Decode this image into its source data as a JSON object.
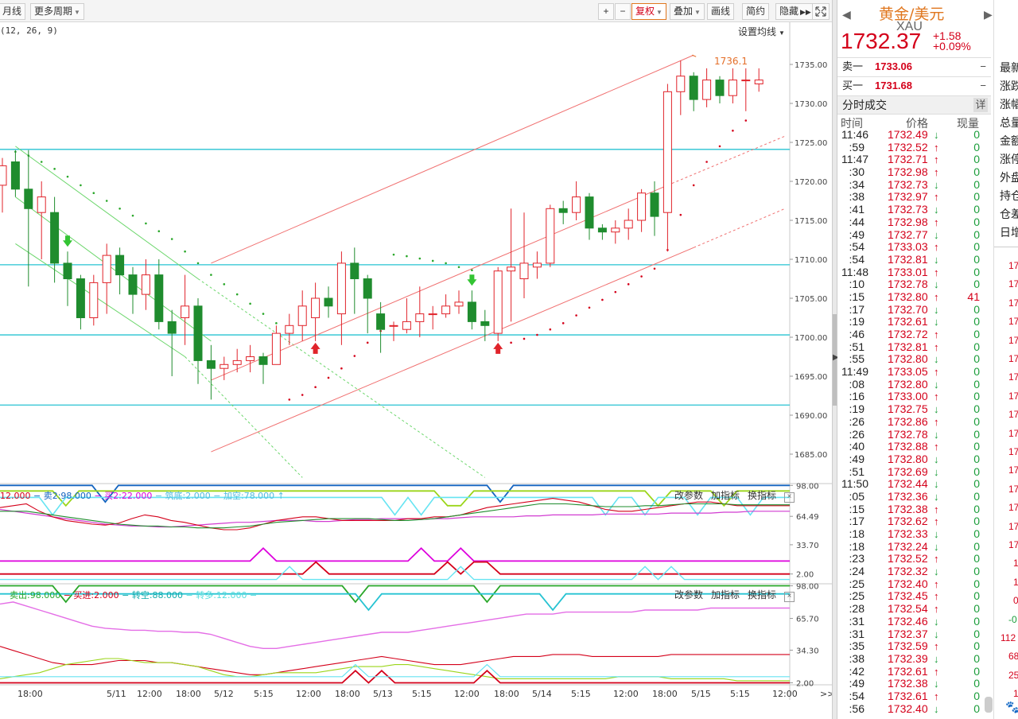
{
  "toolbar": {
    "monthly": "月线",
    "more_periods": "更多周期",
    "plus": "+",
    "minus": "−",
    "adjust": "复权",
    "overlay": "叠加",
    "draw": "画线",
    "simple": "简约",
    "hide": "隐藏",
    "hide_arrows": "▶▶",
    "fullscreen_icon": "fullscreen-icon"
  },
  "chart_header": {
    "macd_params": "(12, 26, 9)",
    "set_ma": "设置均线"
  },
  "colors": {
    "up": "#e0232a",
    "down": "#1f8c2e",
    "hline": "#27c3d2",
    "channel_red": "#f07070",
    "channel_green": "#6bd66b",
    "price_red": "#d4001a",
    "ma_orange": "#e46f2a"
  },
  "chart_data": {
    "type": "candlestick",
    "ylim": [
      1681.5,
      1737.5
    ],
    "yticks": [
      "1735.00",
      "1730.00",
      "1725.00",
      "1720.00",
      "1715.00",
      "1710.00",
      "1705.00",
      "1700.00",
      "1695.00",
      "1690.00",
      "1685.00"
    ],
    "ytick_values": [
      1735,
      1730,
      1725,
      1720,
      1715,
      1710,
      1705,
      1700,
      1695,
      1690,
      1685
    ],
    "xticks": [
      "18:00",
      "5/11",
      "12:00",
      "18:00",
      "5/12",
      "5:15",
      "12:00",
      "18:00",
      "5/13",
      "5:15",
      "12:00",
      "18:00",
      "5/14",
      "5:15",
      "12:00",
      "18:00",
      "5/15",
      "5:15",
      "12:00"
    ],
    "peak_label": "1736.1",
    "horizontal_levels": [
      1724.1,
      1709.3,
      1700.3,
      1691.3
    ],
    "candles": [
      [
        1719.5,
        1722.0,
        1716.0,
        1723.0
      ],
      [
        1722.5,
        1719.0,
        1718.0,
        1724.0
      ],
      [
        1719.0,
        1716.5,
        1706.5,
        1724.0
      ],
      [
        1716.0,
        1718.0,
        1710.0,
        1720.0
      ],
      [
        1716.0,
        1709.5,
        1707.0,
        1718.0
      ],
      [
        1709.5,
        1707.5,
        1704.0,
        1711.0
      ],
      [
        1707.5,
        1702.5,
        1701.0,
        1708.0
      ],
      [
        1702.5,
        1707.0,
        1701.5,
        1708.0
      ],
      [
        1707.0,
        1710.5,
        1703.0,
        1712.0
      ],
      [
        1710.5,
        1708.0,
        1705.5,
        1711.5
      ],
      [
        1708.0,
        1705.5,
        1703.0,
        1709.0
      ],
      [
        1705.5,
        1708.0,
        1703.5,
        1710.0
      ],
      [
        1708.0,
        1702.0,
        1701.0,
        1710.0
      ],
      [
        1702.0,
        1700.5,
        1695.0,
        1703.5
      ],
      [
        1702.5,
        1704.0,
        1699.0,
        1708.0
      ],
      [
        1704.0,
        1697.0,
        1694.0,
        1705.0
      ],
      [
        1697.0,
        1696.0,
        1692.0,
        1699.0
      ],
      [
        1696.0,
        1696.5,
        1694.5,
        1697.5
      ],
      [
        1696.5,
        1697.0,
        1695.5,
        1698.5
      ],
      [
        1697.0,
        1697.5,
        1695.5,
        1699.0
      ],
      [
        1697.5,
        1696.5,
        1694.0,
        1698.0
      ],
      [
        1696.5,
        1700.5,
        1696.5,
        1701.5
      ],
      [
        1700.5,
        1701.5,
        1699.0,
        1703.0
      ],
      [
        1701.5,
        1704.0,
        1699.5,
        1706.0
      ],
      [
        1702.5,
        1705.0,
        1699.5,
        1707.0
      ],
      [
        1705.0,
        1704.0,
        1702.5,
        1706.5
      ],
      [
        1703.0,
        1709.5,
        1699.0,
        1711.0
      ],
      [
        1709.5,
        1707.5,
        1703.0,
        1711.5
      ],
      [
        1707.5,
        1705.0,
        1700.5,
        1708.0
      ],
      [
        1703.0,
        1701.0,
        1698.0,
        1704.5
      ],
      [
        1701.5,
        1701.5,
        1699.5,
        1702.0
      ],
      [
        1701.0,
        1702.0,
        1700.5,
        1705.0
      ],
      [
        1702.0,
        1703.0,
        1700.0,
        1706.5
      ],
      [
        1703.0,
        1703.0,
        1701.0,
        1704.0
      ],
      [
        1703.0,
        1704.0,
        1702.5,
        1705.5
      ],
      [
        1704.0,
        1704.5,
        1703.0,
        1706.0
      ],
      [
        1704.5,
        1702.0,
        1701.0,
        1706.0
      ],
      [
        1702.0,
        1701.5,
        1699.5,
        1703.5
      ],
      [
        1700.5,
        1708.5,
        1699.5,
        1709.0
      ],
      [
        1708.5,
        1709.0,
        1702.0,
        1716.5
      ],
      [
        1707.5,
        1709.5,
        1705.0,
        1716.0
      ],
      [
        1709.0,
        1709.5,
        1707.5,
        1711.0
      ],
      [
        1709.5,
        1716.5,
        1709.0,
        1717.0
      ],
      [
        1716.5,
        1716.0,
        1714.5,
        1717.5
      ],
      [
        1716.0,
        1718.0,
        1715.0,
        1720.0
      ],
      [
        1718.0,
        1714.0,
        1712.5,
        1718.5
      ],
      [
        1714.0,
        1713.5,
        1712.5,
        1714.5
      ],
      [
        1713.5,
        1714.0,
        1712.0,
        1715.0
      ],
      [
        1714.0,
        1715.0,
        1712.5,
        1716.5
      ],
      [
        1715.0,
        1718.5,
        1713.5,
        1719.0
      ],
      [
        1718.5,
        1715.5,
        1713.0,
        1720.0
      ],
      [
        1716.0,
        1731.5,
        1711.0,
        1732.5
      ],
      [
        1731.5,
        1733.5,
        1728.5,
        1735.5
      ],
      [
        1733.5,
        1730.5,
        1729.0,
        1734.0
      ],
      [
        1730.5,
        1733.0,
        1729.5,
        1734.5
      ],
      [
        1733.0,
        1731.0,
        1730.0,
        1733.5
      ],
      [
        1731.0,
        1733.0,
        1730.0,
        1734.5
      ],
      [
        1733.0,
        1733.0,
        1729.0,
        1734.5
      ],
      [
        1732.5,
        1733.0,
        1731.5,
        1734.5
      ]
    ],
    "buy_arrows": [
      24,
      38
    ],
    "sell_arrows": [
      5,
      36
    ],
    "sar_dots": [
      [
        1,
        1723.8
      ],
      [
        2,
        1723.3
      ],
      [
        3,
        1722.5
      ],
      [
        4,
        1721.6
      ],
      [
        5,
        1720.6
      ],
      [
        6,
        1719.5
      ],
      [
        7,
        1718.5
      ],
      [
        8,
        1717.5
      ],
      [
        9,
        1716.5
      ],
      [
        10,
        1715.6
      ],
      [
        11,
        1714.6
      ],
      [
        12,
        1713.6
      ],
      [
        13,
        1712.6
      ],
      [
        14,
        1711.0
      ],
      [
        15,
        1709.5
      ],
      [
        16,
        1708.0
      ],
      [
        17,
        1706.8
      ],
      [
        18,
        1705.5
      ],
      [
        19,
        1704.3
      ],
      [
        20,
        1703.0
      ],
      [
        21,
        1701.8
      ],
      [
        22,
        1692.0
      ],
      [
        23,
        1692.6
      ],
      [
        24,
        1693.6
      ],
      [
        25,
        1694.8
      ],
      [
        26,
        1696.0
      ],
      [
        27,
        1697.6
      ],
      [
        28,
        1699.3
      ],
      [
        29,
        1700.8
      ],
      [
        30,
        1710.6
      ],
      [
        31,
        1710.4
      ],
      [
        32,
        1710.1
      ],
      [
        33,
        1709.8
      ],
      [
        34,
        1709.5
      ],
      [
        35,
        1709.0
      ],
      [
        36,
        1708.6
      ],
      [
        38,
        1698.5
      ],
      [
        39,
        1699.3
      ],
      [
        40,
        1699.8
      ],
      [
        41,
        1700.3
      ],
      [
        42,
        1701.0
      ],
      [
        43,
        1701.8
      ],
      [
        44,
        1702.8
      ],
      [
        45,
        1703.8
      ],
      [
        46,
        1704.8
      ],
      [
        47,
        1705.8
      ],
      [
        48,
        1706.8
      ],
      [
        49,
        1707.8
      ],
      [
        50,
        1708.8
      ],
      [
        51,
        1711.2
      ],
      [
        52,
        1715.7
      ],
      [
        53,
        1719.5
      ],
      [
        54,
        1722.5
      ],
      [
        55,
        1724.5
      ],
      [
        56,
        1726.5
      ],
      [
        57,
        1727.8
      ]
    ],
    "indicator1": {
      "legend": [
        {
          "text": "12.000",
          "color": "#d4001a"
        },
        {
          "text": " − ",
          "color": "#1565c0"
        },
        {
          "text": "卖2:98.000",
          "color": "#1565c0"
        },
        {
          "text": " − ",
          "color": "#d0d"
        },
        {
          "text": "买2:22.000",
          "color": "#d0d"
        },
        {
          "text": " − ",
          "color": "#5bd"
        },
        {
          "text": "筑底:2.000",
          "color": "#5bd"
        },
        {
          "text": " − ",
          "color": "#5bd"
        },
        {
          "text": "加空:78.000",
          "color": "#5bd"
        },
        {
          "text": " ↑",
          "color": "#5bd"
        }
      ],
      "yticks": [
        "98.00",
        "64.49",
        "33.70",
        "2.00"
      ],
      "ylim": [
        0,
        100
      ]
    },
    "indicator2": {
      "legend": [
        {
          "text": "卖出:98.000",
          "color": "#2aa72a"
        },
        {
          "text": " − ",
          "color": "#d4001a"
        },
        {
          "text": "买进:2.000",
          "color": "#d4001a"
        },
        {
          "text": " − ",
          "color": "#1aa"
        },
        {
          "text": "转空:88.000",
          "color": "#1aa"
        },
        {
          "text": " − ",
          "color": "#5dd"
        },
        {
          "text": "转多:12.000",
          "color": "#5dd"
        },
        {
          "text": " − ",
          "color": "#5dd"
        }
      ],
      "yticks": [
        "98.00",
        "65.70",
        "34.30",
        "2.00"
      ],
      "ylim": [
        0,
        100
      ]
    },
    "indicator_tools": [
      "改参数",
      "加指标",
      "换指标"
    ]
  },
  "quote": {
    "name": "黄金/美元",
    "code": "XAU",
    "price": "1732.37",
    "change": "+1.58",
    "change_pct": "+0.09%",
    "ask_label": "卖一",
    "ask": "1733.06",
    "bid_label": "买一",
    "bid": "1731.68",
    "dash": "−",
    "ticks_title": "分时成交",
    "detail": "详",
    "col_time": "时间",
    "col_price": "价格",
    "col_vol": "现量",
    "ticks": [
      {
        "t": "11:46",
        "p": "1732.49",
        "d": "dn",
        "v": "0"
      },
      {
        "t": ":59",
        "p": "1732.52",
        "d": "up",
        "v": "0"
      },
      {
        "t": "11:47",
        "p": "1732.71",
        "d": "up",
        "v": "0"
      },
      {
        "t": ":30",
        "p": "1732.98",
        "d": "up",
        "v": "0"
      },
      {
        "t": ":34",
        "p": "1732.73",
        "d": "dn",
        "v": "0"
      },
      {
        "t": ":38",
        "p": "1732.97",
        "d": "up",
        "v": "0"
      },
      {
        "t": ":41",
        "p": "1732.73",
        "d": "dn",
        "v": "0"
      },
      {
        "t": ":44",
        "p": "1732.98",
        "d": "up",
        "v": "0"
      },
      {
        "t": ":49",
        "p": "1732.77",
        "d": "dn",
        "v": "0"
      },
      {
        "t": ":54",
        "p": "1733.03",
        "d": "up",
        "v": "0"
      },
      {
        "t": ":54",
        "p": "1732.81",
        "d": "dn",
        "v": "0"
      },
      {
        "t": "11:48",
        "p": "1733.01",
        "d": "up",
        "v": "0"
      },
      {
        "t": ":10",
        "p": "1732.78",
        "d": "dn",
        "v": "0"
      },
      {
        "t": ":15",
        "p": "1732.80",
        "d": "up",
        "v": "41"
      },
      {
        "t": ":17",
        "p": "1732.70",
        "d": "dn",
        "v": "0"
      },
      {
        "t": ":19",
        "p": "1732.61",
        "d": "dn",
        "v": "0"
      },
      {
        "t": ":46",
        "p": "1732.72",
        "d": "up",
        "v": "0"
      },
      {
        "t": ":51",
        "p": "1732.81",
        "d": "up",
        "v": "0"
      },
      {
        "t": ":55",
        "p": "1732.80",
        "d": "dn",
        "v": "0"
      },
      {
        "t": "11:49",
        "p": "1733.05",
        "d": "up",
        "v": "0"
      },
      {
        "t": ":08",
        "p": "1732.80",
        "d": "dn",
        "v": "0"
      },
      {
        "t": ":16",
        "p": "1733.00",
        "d": "up",
        "v": "0"
      },
      {
        "t": ":19",
        "p": "1732.75",
        "d": "dn",
        "v": "0"
      },
      {
        "t": ":26",
        "p": "1732.86",
        "d": "up",
        "v": "0"
      },
      {
        "t": ":26",
        "p": "1732.78",
        "d": "dn",
        "v": "0"
      },
      {
        "t": ":40",
        "p": "1732.88",
        "d": "up",
        "v": "0"
      },
      {
        "t": ":49",
        "p": "1732.80",
        "d": "dn",
        "v": "0"
      },
      {
        "t": ":51",
        "p": "1732.69",
        "d": "dn",
        "v": "0"
      },
      {
        "t": "11:50",
        "p": "1732.44",
        "d": "dn",
        "v": "0"
      },
      {
        "t": ":05",
        "p": "1732.36",
        "d": "dn",
        "v": "0"
      },
      {
        "t": ":15",
        "p": "1732.38",
        "d": "up",
        "v": "0"
      },
      {
        "t": ":17",
        "p": "1732.62",
        "d": "up",
        "v": "0"
      },
      {
        "t": ":18",
        "p": "1732.33",
        "d": "dn",
        "v": "0"
      },
      {
        "t": ":18",
        "p": "1732.24",
        "d": "dn",
        "v": "0"
      },
      {
        "t": ":23",
        "p": "1732.52",
        "d": "up",
        "v": "0"
      },
      {
        "t": ":24",
        "p": "1732.32",
        "d": "dn",
        "v": "0"
      },
      {
        "t": ":25",
        "p": "1732.40",
        "d": "up",
        "v": "0"
      },
      {
        "t": ":25",
        "p": "1732.45",
        "d": "up",
        "v": "0"
      },
      {
        "t": ":28",
        "p": "1732.54",
        "d": "up",
        "v": "0"
      },
      {
        "t": ":31",
        "p": "1732.46",
        "d": "dn",
        "v": "0"
      },
      {
        "t": ":31",
        "p": "1732.37",
        "d": "dn",
        "v": "0"
      },
      {
        "t": ":35",
        "p": "1732.59",
        "d": "up",
        "v": "0"
      },
      {
        "t": ":38",
        "p": "1732.39",
        "d": "dn",
        "v": "0"
      },
      {
        "t": ":42",
        "p": "1732.61",
        "d": "up",
        "v": "0"
      },
      {
        "t": ":49",
        "p": "1732.38",
        "d": "dn",
        "v": "0"
      },
      {
        "t": ":54",
        "p": "1732.61",
        "d": "up",
        "v": "0"
      },
      {
        "t": ":56",
        "p": "1732.40",
        "d": "dn",
        "v": "0"
      }
    ]
  },
  "stats": {
    "labels": [
      "最新",
      "涨跌",
      "涨幅",
      "总量",
      "金额",
      "涨停",
      "外盘",
      "持仓",
      "仓差",
      "日增"
    ],
    "values": [
      "17",
      "17",
      "17",
      "17",
      "17",
      "17",
      "17",
      "17",
      "17",
      "17",
      "17",
      "17",
      "17",
      "17",
      "17",
      "17",
      "1",
      "1",
      "0",
      "-0",
      "112",
      "68",
      "25",
      "1"
    ]
  }
}
